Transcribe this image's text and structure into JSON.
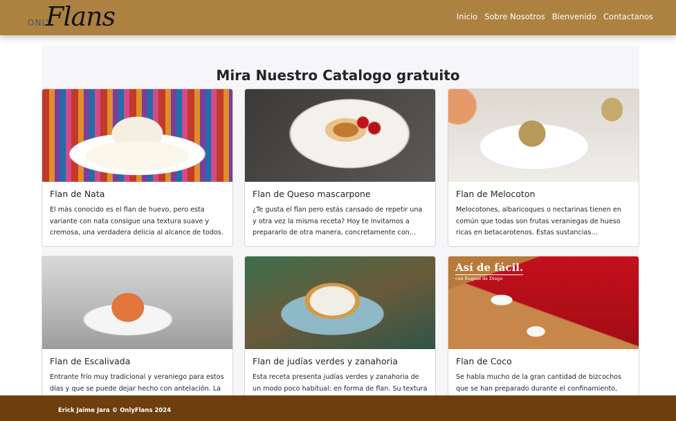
{
  "nav": {
    "brand_prefix": "ONLY",
    "brand_name": "Flans",
    "links": [
      "Inicio",
      "Sobre Nosotros",
      "Bienvenido",
      "Contactanos"
    ]
  },
  "catalog": {
    "title": "Mira Nuestro Catalogo gratuito",
    "cards": [
      {
        "title": "Flan de Nata",
        "text": "El más conocido es el flan de huevo, pero esta variante con nata consigue una textura suave y cremosa, una verdadera delicia al alcance de todos."
      },
      {
        "title": "Flan de Queso mascarpone",
        "text": "¿Te gusta el flan pero estás cansado de repetir una y otra vez la misma receta? Hoy te invitamos a prepararlo de otra manera, concretamente con queso mascarpone."
      },
      {
        "title": "Flan de Melocoton",
        "text": "Melocotones, albaricoques o nectarinas tienen en común que todas son frutas veraniegas de hueso ricas en betacarotenos. Estas sustancias antioxidantes..."
      },
      {
        "title": "Flan de Escalivada",
        "text": "Entrante frío muy tradicional y veraniego para estos días y que se puede dejar hecho con antelación. La"
      },
      {
        "title": "Flan de judías verdes y zanahoria",
        "text": "Esta receta presenta judías verdes y zanahoria de un modo poco habitual: en forma de flan. Su textura"
      },
      {
        "title": "Flan de Coco",
        "text": "Se habla mucho de la gran cantidad de bizcochos que se han preparado durante el confinamiento, pero ¿y"
      }
    ],
    "coco_badge_title": "Así de fácil.",
    "coco_badge_sub": "con Eugeni de Diego"
  },
  "footer": {
    "text": "Erick Jaime Jara © OnlyFlans 2024"
  },
  "colors": {
    "navbar": "#ad8240",
    "footer": "#6e3f0d",
    "panel": "#f6f6f8"
  }
}
